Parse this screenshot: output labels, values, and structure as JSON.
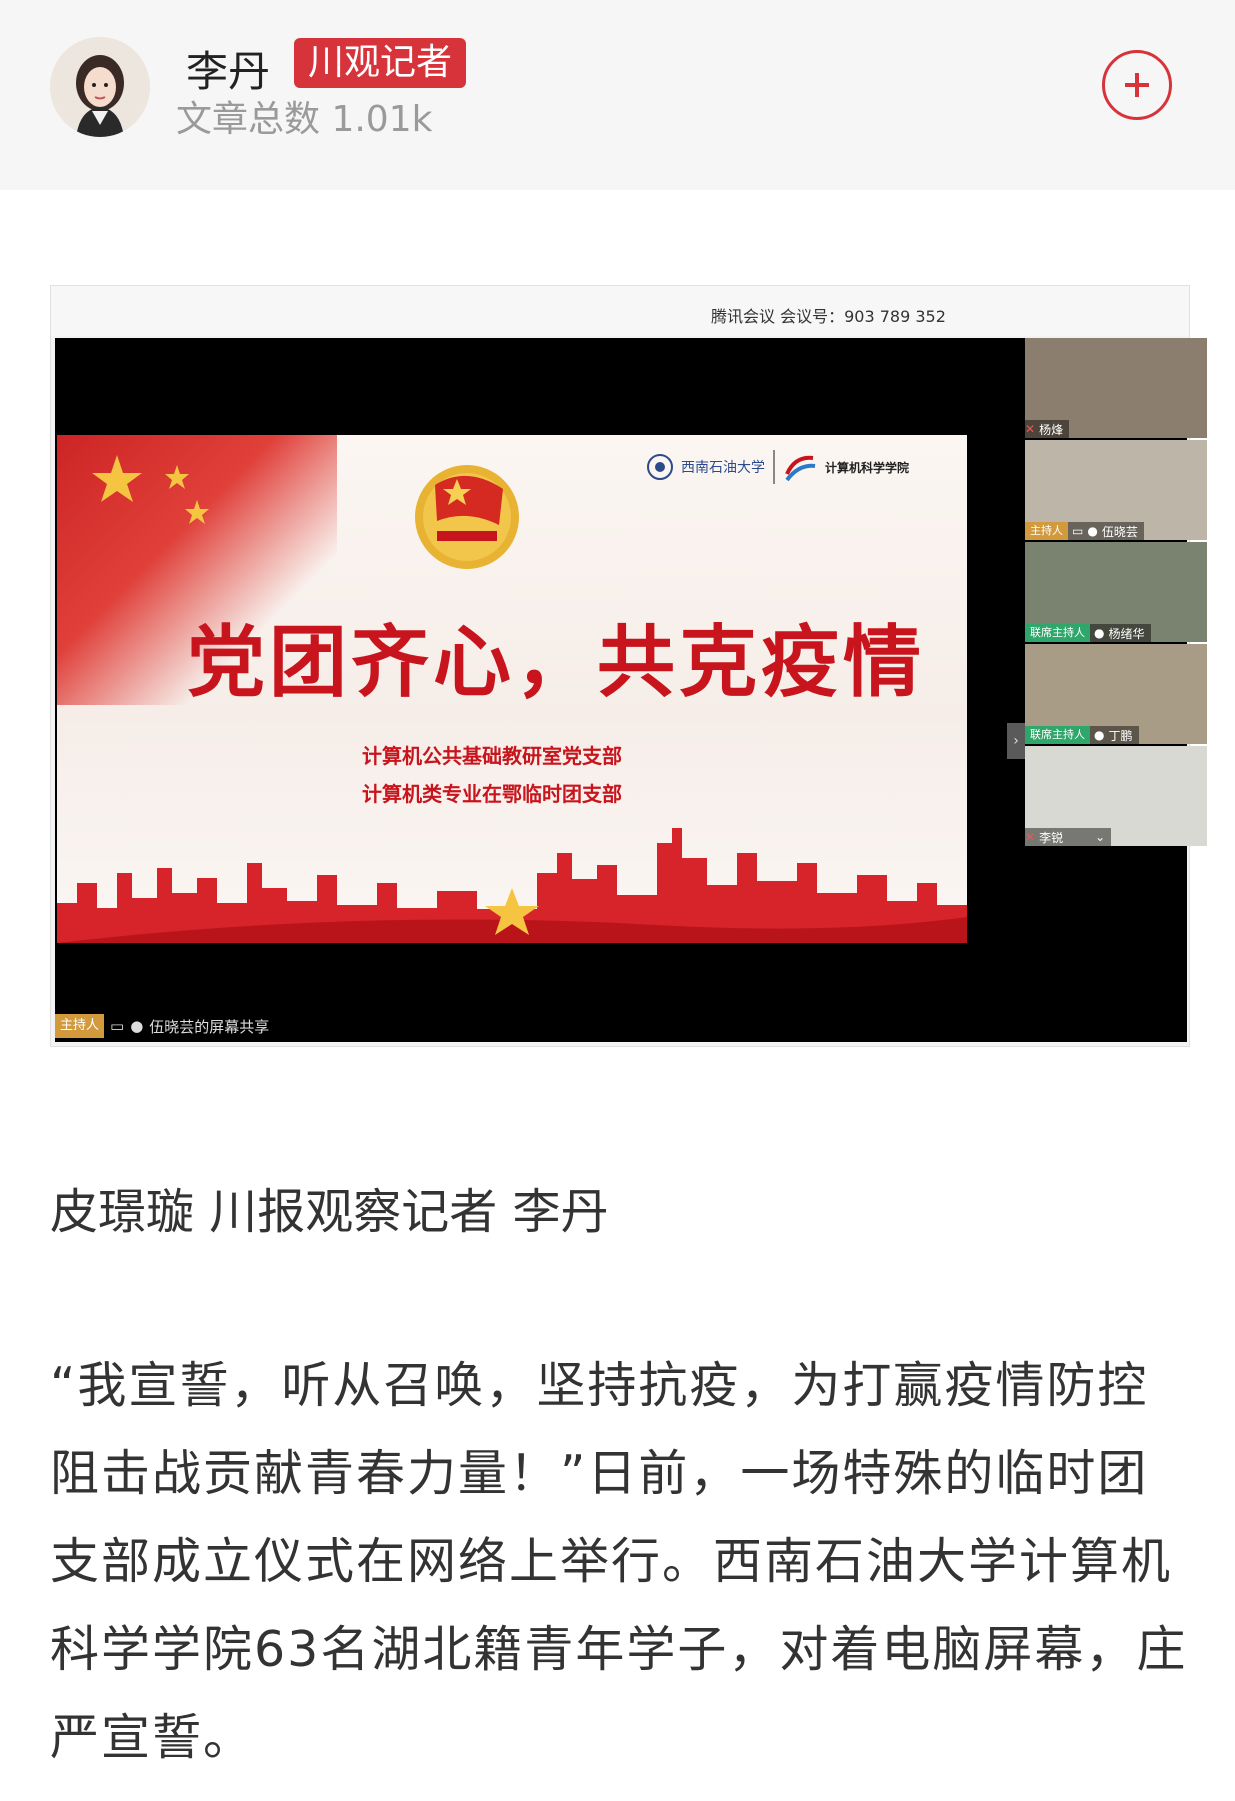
{
  "author": {
    "name": "李丹",
    "badge": "川观记者",
    "article_count": "文章总数 1.01k",
    "follow_icon": "plus-icon",
    "accent_color": "#d6343a"
  },
  "screenshot": {
    "meeting_info": "腾讯会议 会议号：903 789 352",
    "slide": {
      "university": "西南石油大学",
      "school": "计算机科学学院",
      "title": "党团齐心，共克疫情",
      "subtitle_1": "计算机公共基础教研室党支部",
      "subtitle_2": "计算机类专业在鄂临时团支部"
    },
    "participants": [
      {
        "name": "杨烽",
        "role": ""
      },
      {
        "name": "伍晓芸",
        "role": "主持人"
      },
      {
        "name": "杨绪华",
        "role": "联席主持人"
      },
      {
        "name": "丁鹏",
        "role": "联席主持人"
      },
      {
        "name": "李锐",
        "role": ""
      }
    ],
    "share_role": "主持人",
    "share_label": "伍晓芸的屏幕共享"
  },
  "article": {
    "byline": "皮璟璇 川报观察记者 李丹",
    "paragraph": "“我宣誓，听从召唤，坚持抗疫，为打赢疫情防控阻击战贡献青春力量！”日前，一场特殊的临时团支部成立仪式在网络上举行。西南石油大学计算机科学学院63名湖北籍青年学子，对着电脑屏幕，庄严宣誓。"
  }
}
